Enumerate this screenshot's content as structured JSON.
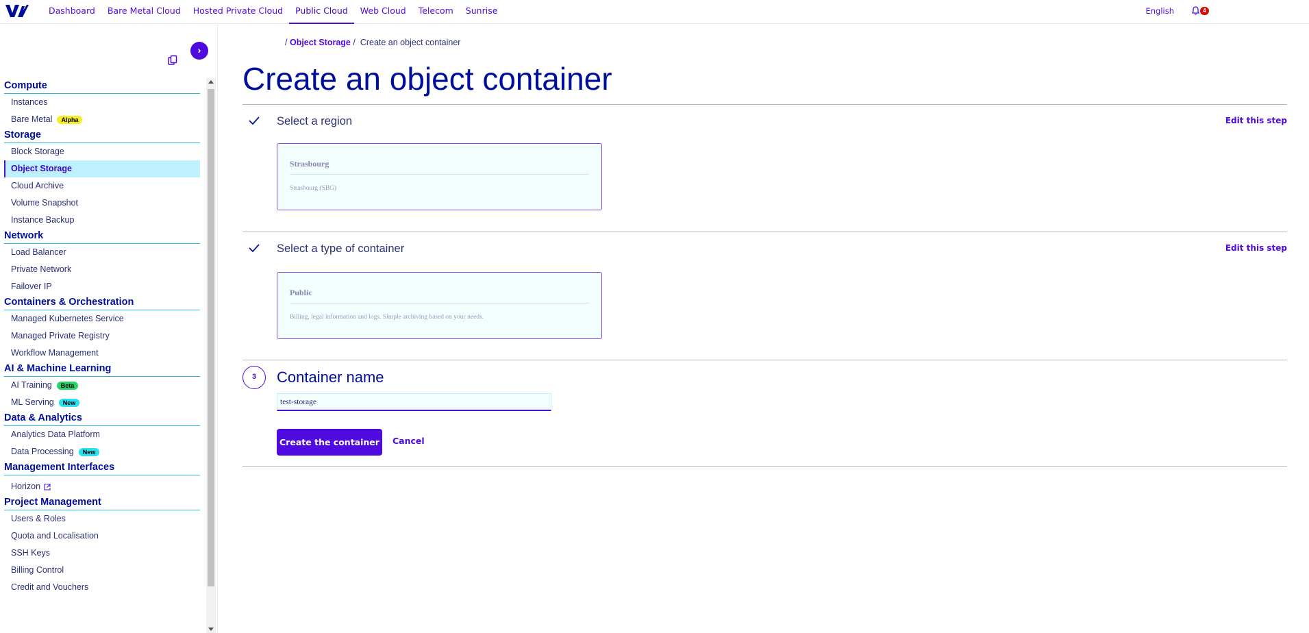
{
  "header": {
    "nav": [
      "Dashboard",
      "Bare Metal Cloud",
      "Hosted Private Cloud",
      "Public Cloud",
      "Web Cloud",
      "Telecom",
      "Sunrise"
    ],
    "active_nav": "Public Cloud",
    "language": "English",
    "notification_count": "4",
    "accent_color": "#4f0ae0"
  },
  "sidebar": {
    "toggle_glyph": "›",
    "sections": [
      {
        "title": "Compute",
        "items": [
          {
            "label": "Instances"
          },
          {
            "label": "Bare Metal",
            "badge": "Alpha"
          }
        ]
      },
      {
        "title": "Storage",
        "items": [
          {
            "label": "Block Storage"
          },
          {
            "label": "Object Storage",
            "active": true
          },
          {
            "label": "Cloud Archive"
          },
          {
            "label": "Volume Snapshot"
          },
          {
            "label": "Instance Backup"
          }
        ]
      },
      {
        "title": "Network",
        "items": [
          {
            "label": "Load Balancer"
          },
          {
            "label": "Private Network"
          },
          {
            "label": "Failover IP"
          }
        ]
      },
      {
        "title": "Containers & Orchestration",
        "items": [
          {
            "label": "Managed Kubernetes Service"
          },
          {
            "label": "Managed Private Registry"
          },
          {
            "label": "Workflow Management"
          }
        ]
      },
      {
        "title": "AI & Machine Learning",
        "items": [
          {
            "label": "AI Training",
            "badge": "Beta"
          },
          {
            "label": "ML Serving",
            "badge": "New"
          }
        ]
      },
      {
        "title": "Data & Analytics",
        "items": [
          {
            "label": "Analytics Data Platform"
          },
          {
            "label": "Data Processing",
            "badge": "New"
          }
        ]
      },
      {
        "title": "Management Interfaces",
        "items": [
          {
            "label": "Horizon",
            "external": true
          }
        ]
      },
      {
        "title": "Project Management",
        "items": [
          {
            "label": "Users & Roles"
          },
          {
            "label": "Quota and Localisation"
          },
          {
            "label": "SSH Keys"
          },
          {
            "label": "Billing Control"
          },
          {
            "label": "Credit and Vouchers"
          }
        ]
      }
    ]
  },
  "breadcrumb": {
    "separator_leading": "/",
    "link": "Object Storage",
    "separator": "/",
    "current": "Create an object container"
  },
  "page_title": "Create an object container",
  "steps": {
    "region": {
      "title": "Select a region",
      "edit_label": "Edit this step",
      "tile_title": "Strasbourg",
      "tile_desc": "Strasbourg (SBG)"
    },
    "type": {
      "title": "Select a type of container",
      "edit_label": "Edit this step",
      "tile_title": "Public",
      "tile_desc": "Billing, legal information and logs. Simple archiving based on your needs."
    },
    "name": {
      "number": "3",
      "title": "Container name",
      "input_value": "test-storage",
      "create_label": "Create the container",
      "cancel_label": "Cancel"
    }
  }
}
